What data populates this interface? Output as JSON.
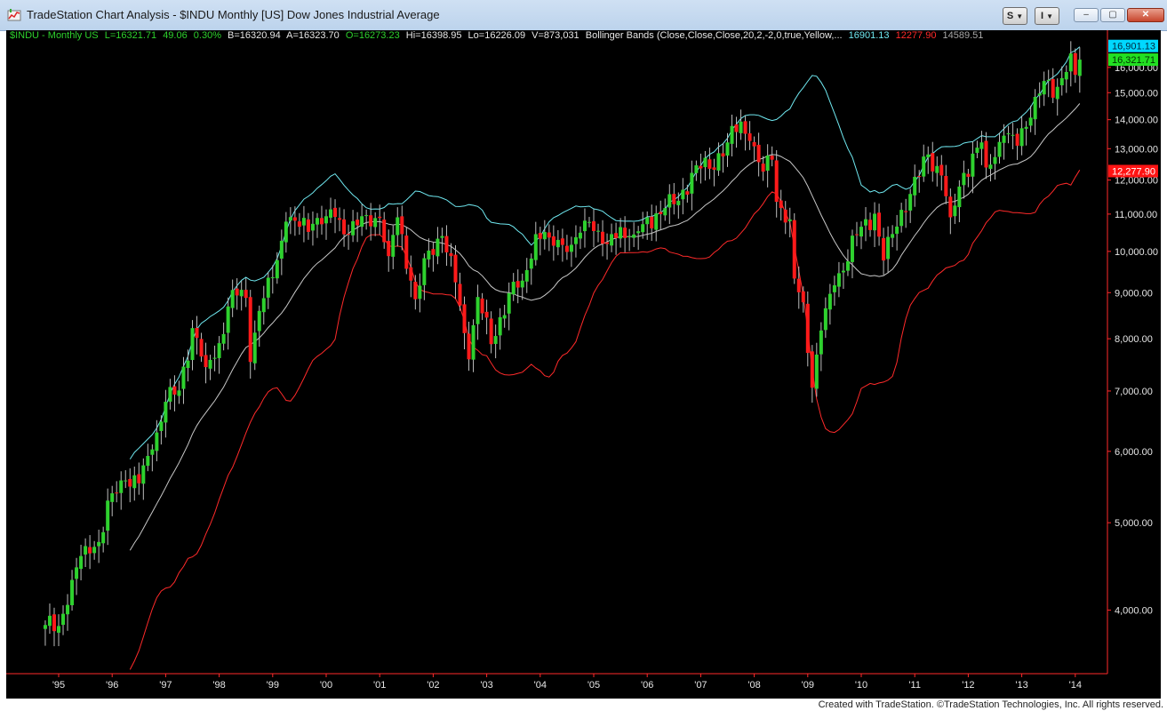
{
  "window": {
    "title": "TradeStation Chart Analysis - $INDU Monthly [US] Dow Jones Industrial Average",
    "btn_s": "S",
    "btn_i": "I",
    "minimize": "–",
    "maximize": "▢",
    "close": "✕"
  },
  "header": {
    "symbol": "$INDU - Monthly  US",
    "last": "L=16321.71",
    "change": "49.06",
    "pct": "0.30%",
    "bid": "B=16320.94",
    "ask": "A=16323.70",
    "open": "O=16273.23",
    "high": "Hi=16398.95",
    "low": "Lo=16226.09",
    "volume": "V=873,031",
    "indicator": "Bollinger Bands (Close,Close,Close,20,2,-2,0,true,Yellow,...",
    "upper": "16901.13",
    "lower": "12277.90",
    "mid": "14589.51"
  },
  "price_tags": {
    "upper": "16,901.13",
    "last": "16,321.71",
    "lower": "12,277.90"
  },
  "footer": "Created with TradeStation. ©TradeStation Technologies, Inc. All rights reserved.",
  "colors": {
    "up": "#2ed12e",
    "down": "#ff1a1a",
    "upper_band": "#6fe8f0",
    "mid_band": "#c8c8c8",
    "lower_band": "#ff2a2a",
    "axis": "#ff2a2a"
  },
  "chart_data": {
    "type": "candlestick",
    "scale": "log",
    "ylim": [
      3400,
      17200
    ],
    "x_ticks": [
      "'95",
      "'96",
      "'97",
      "'98",
      "'99",
      "'00",
      "'01",
      "'02",
      "'03",
      "'04",
      "'05",
      "'06",
      "'07",
      "'08",
      "'09",
      "'10",
      "'11",
      "'12",
      "'13",
      "'14"
    ],
    "y_ticks": [
      {
        "v": 4000,
        "label": "4,000.00"
      },
      {
        "v": 5000,
        "label": "5,000.00"
      },
      {
        "v": 6000,
        "label": "6,000.00"
      },
      {
        "v": 7000,
        "label": "7,000.00"
      },
      {
        "v": 8000,
        "label": "8,000.00"
      },
      {
        "v": 9000,
        "label": "9,000.00"
      },
      {
        "v": 10000,
        "label": "10,000.00"
      },
      {
        "v": 11000,
        "label": "11,000.00"
      },
      {
        "v": 12000,
        "label": "12,000.00"
      },
      {
        "v": 13000,
        "label": "13,000.00"
      },
      {
        "v": 14000,
        "label": "14,000.00"
      },
      {
        "v": 15000,
        "label": "15,000.00"
      },
      {
        "v": 16000,
        "label": "16,000.00"
      }
    ],
    "monthly_close_anchors": [
      [
        "1994-10",
        3850
      ],
      [
        "1995-01",
        3840
      ],
      [
        "1995-04",
        4320
      ],
      [
        "1995-07",
        4710
      ],
      [
        "1995-10",
        4760
      ],
      [
        "1996-01",
        5390
      ],
      [
        "1996-04",
        5570
      ],
      [
        "1996-07",
        5530
      ],
      [
        "1996-10",
        6030
      ],
      [
        "1997-01",
        6810
      ],
      [
        "1997-04",
        7010
      ],
      [
        "1997-07",
        8220
      ],
      [
        "1997-10",
        7440
      ],
      [
        "1998-01",
        7910
      ],
      [
        "1998-04",
        9060
      ],
      [
        "1998-07",
        8880
      ],
      [
        "1998-08",
        7540
      ],
      [
        "1998-10",
        8590
      ],
      [
        "1999-01",
        9360
      ],
      [
        "1999-04",
        10790
      ],
      [
        "1999-07",
        10650
      ],
      [
        "1999-10",
        10730
      ],
      [
        "2000-01",
        10940
      ],
      [
        "2000-03",
        10920
      ],
      [
        "2000-06",
        10450
      ],
      [
        "2000-10",
        10970
      ],
      [
        "2001-01",
        10890
      ],
      [
        "2001-03",
        9880
      ],
      [
        "2001-05",
        10910
      ],
      [
        "2001-09",
        8850
      ],
      [
        "2001-12",
        10020
      ],
      [
        "2002-03",
        10400
      ],
      [
        "2002-06",
        9240
      ],
      [
        "2002-09",
        7590
      ],
      [
        "2002-11",
        8900
      ],
      [
        "2003-02",
        7890
      ],
      [
        "2003-06",
        8990
      ],
      [
        "2003-09",
        9280
      ],
      [
        "2003-12",
        10450
      ],
      [
        "2004-03",
        10360
      ],
      [
        "2004-08",
        10170
      ],
      [
        "2004-12",
        10780
      ],
      [
        "2005-04",
        10190
      ],
      [
        "2005-07",
        10640
      ],
      [
        "2005-10",
        10440
      ],
      [
        "2005-12",
        10720
      ],
      [
        "2006-05",
        11170
      ],
      [
        "2006-08",
        11380
      ],
      [
        "2006-12",
        12460
      ],
      [
        "2007-03",
        12350
      ],
      [
        "2007-07",
        13210
      ],
      [
        "2007-10",
        13930
      ],
      [
        "2007-12",
        13260
      ],
      [
        "2008-03",
        12260
      ],
      [
        "2008-05",
        12640
      ],
      [
        "2008-06",
        11350
      ],
      [
        "2008-09",
        10850
      ],
      [
        "2008-10",
        9330
      ],
      [
        "2008-12",
        8780
      ],
      [
        "2009-02",
        7060
      ],
      [
        "2009-04",
        8170
      ],
      [
        "2009-07",
        9170
      ],
      [
        "2009-12",
        10430
      ],
      [
        "2010-04",
        11010
      ],
      [
        "2010-06",
        9770
      ],
      [
        "2010-10",
        11120
      ],
      [
        "2010-12",
        11580
      ],
      [
        "2011-04",
        12810
      ],
      [
        "2011-07",
        12140
      ],
      [
        "2011-09",
        10910
      ],
      [
        "2011-12",
        12220
      ],
      [
        "2012-04",
        13210
      ],
      [
        "2012-05",
        12390
      ],
      [
        "2012-09",
        13440
      ],
      [
        "2012-12",
        13100
      ],
      [
        "2013-04",
        14840
      ],
      [
        "2013-07",
        15500
      ],
      [
        "2013-08",
        14810
      ],
      [
        "2013-12",
        16580
      ],
      [
        "2014-01",
        15700
      ],
      [
        "2014-02",
        16322
      ]
    ]
  }
}
